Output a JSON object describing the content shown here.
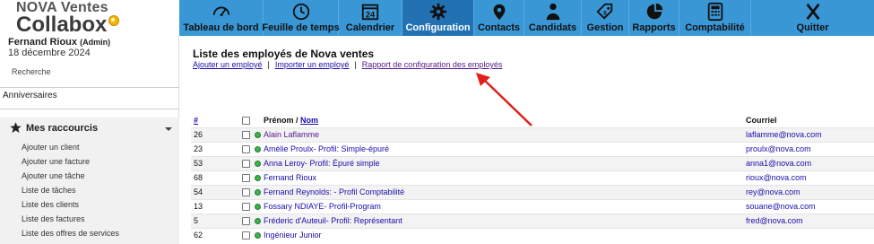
{
  "brand": {
    "line1": "NOVA Ventes",
    "line2": "Collabox"
  },
  "nav": [
    {
      "key": "dashboard",
      "label": "Tableau de bord",
      "icon": "gauge-icon",
      "active": false
    },
    {
      "key": "timesheet",
      "label": "Feuille de temps",
      "icon": "clock-icon",
      "active": false
    },
    {
      "key": "calendar",
      "label": "Calendrier",
      "icon": "calendar-icon",
      "day": "24",
      "active": false
    },
    {
      "key": "configuration",
      "label": "Configuration",
      "icon": "gear-icon",
      "active": true
    },
    {
      "key": "contacts",
      "label": "Contacts",
      "icon": "map-pin-icon",
      "active": false
    },
    {
      "key": "candidates",
      "label": "Candidats",
      "icon": "people-icon",
      "active": false
    },
    {
      "key": "management",
      "label": "Gestion",
      "icon": "tag-icon",
      "active": false
    },
    {
      "key": "reports",
      "label": "Rapports",
      "icon": "pie-chart-icon",
      "active": false
    },
    {
      "key": "accounting",
      "label": "Comptabilité",
      "icon": "calculator-icon",
      "active": false
    },
    {
      "key": "quit",
      "label": "Quitter",
      "icon": "x-icon",
      "active": false
    }
  ],
  "user": {
    "name": "Fernand Rioux",
    "role": "(Admin)",
    "date": "18 décembre 2024"
  },
  "sidebar": {
    "search": "Recherche",
    "anniversaries": "Anniversaires",
    "shortcuts_title": "Mes raccourcis",
    "shortcuts": [
      "Ajouter un client",
      "Ajouter une facture",
      "Ajouter une tâche",
      "Liste de tâches",
      "Liste des clients",
      "Liste des factures",
      "Liste des offres de services"
    ]
  },
  "main": {
    "title": "Liste des employés de Nova ventes",
    "actions": [
      "Ajouter un employé",
      "Importer un employé",
      "Rapport de configuration des employés"
    ],
    "separator": "|",
    "table": {
      "col_num": "#",
      "col_name_prefix": "Prénom / ",
      "col_name_link": "Nom",
      "col_email": "Courriel",
      "rows": [
        {
          "id": "26",
          "name": "Alain Laflamme",
          "email": "laflamme@nova.com"
        },
        {
          "id": "23",
          "name": "Amélie Proulx- Profil: Simple-épuré",
          "email": "proulx@nova.com"
        },
        {
          "id": "53",
          "name": "Anna Leroy- Profil: Épuré simple",
          "email": "anna1@nova.com"
        },
        {
          "id": "68",
          "name": "Fernand Rioux",
          "email": "rioux@nova.com"
        },
        {
          "id": "54",
          "name": "Fernand Reynolds: - Profil Comptabilité",
          "email": "rey@nova.com"
        },
        {
          "id": "13",
          "name": "Fossary NDIAYE- Profil-Program",
          "email": "souane@nova.com"
        },
        {
          "id": "5",
          "name": "Fréderic d'Auteuil- Profil: Représentant",
          "email": "fred@nova.com"
        },
        {
          "id": "62",
          "name": "Ingénieur Junior",
          "email": ""
        }
      ]
    }
  },
  "colors": {
    "nav_bg": "#3a97d6",
    "nav_active": "#2272b3",
    "link": "#1a0dab",
    "visited": "#551a8b",
    "status_active": "#3ab54a",
    "arrow": "#e0201b"
  }
}
